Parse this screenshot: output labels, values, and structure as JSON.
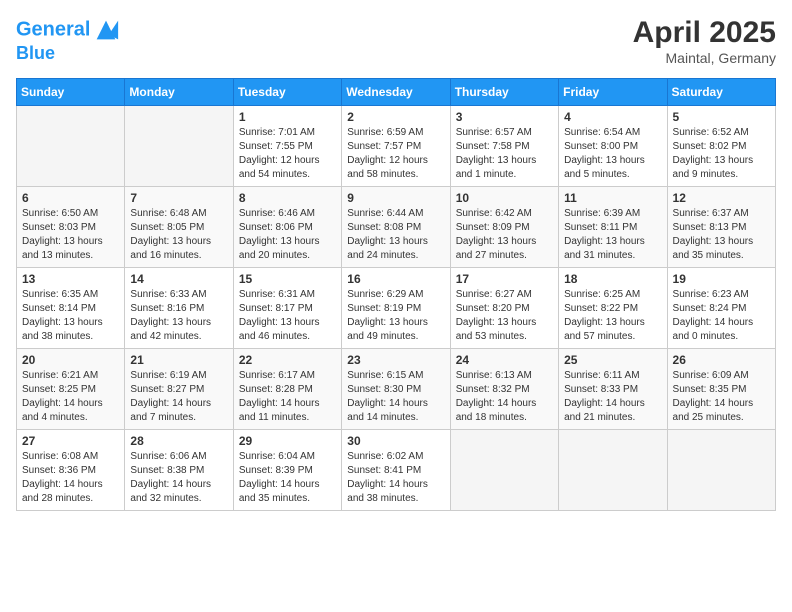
{
  "header": {
    "logo_line1": "General",
    "logo_line2": "Blue",
    "month_year": "April 2025",
    "location": "Maintal, Germany"
  },
  "days_of_week": [
    "Sunday",
    "Monday",
    "Tuesday",
    "Wednesday",
    "Thursday",
    "Friday",
    "Saturday"
  ],
  "weeks": [
    [
      {
        "day": "",
        "info": ""
      },
      {
        "day": "",
        "info": ""
      },
      {
        "day": "1",
        "info": "Sunrise: 7:01 AM\nSunset: 7:55 PM\nDaylight: 12 hours and 54 minutes."
      },
      {
        "day": "2",
        "info": "Sunrise: 6:59 AM\nSunset: 7:57 PM\nDaylight: 12 hours and 58 minutes."
      },
      {
        "day": "3",
        "info": "Sunrise: 6:57 AM\nSunset: 7:58 PM\nDaylight: 13 hours and 1 minute."
      },
      {
        "day": "4",
        "info": "Sunrise: 6:54 AM\nSunset: 8:00 PM\nDaylight: 13 hours and 5 minutes."
      },
      {
        "day": "5",
        "info": "Sunrise: 6:52 AM\nSunset: 8:02 PM\nDaylight: 13 hours and 9 minutes."
      }
    ],
    [
      {
        "day": "6",
        "info": "Sunrise: 6:50 AM\nSunset: 8:03 PM\nDaylight: 13 hours and 13 minutes."
      },
      {
        "day": "7",
        "info": "Sunrise: 6:48 AM\nSunset: 8:05 PM\nDaylight: 13 hours and 16 minutes."
      },
      {
        "day": "8",
        "info": "Sunrise: 6:46 AM\nSunset: 8:06 PM\nDaylight: 13 hours and 20 minutes."
      },
      {
        "day": "9",
        "info": "Sunrise: 6:44 AM\nSunset: 8:08 PM\nDaylight: 13 hours and 24 minutes."
      },
      {
        "day": "10",
        "info": "Sunrise: 6:42 AM\nSunset: 8:09 PM\nDaylight: 13 hours and 27 minutes."
      },
      {
        "day": "11",
        "info": "Sunrise: 6:39 AM\nSunset: 8:11 PM\nDaylight: 13 hours and 31 minutes."
      },
      {
        "day": "12",
        "info": "Sunrise: 6:37 AM\nSunset: 8:13 PM\nDaylight: 13 hours and 35 minutes."
      }
    ],
    [
      {
        "day": "13",
        "info": "Sunrise: 6:35 AM\nSunset: 8:14 PM\nDaylight: 13 hours and 38 minutes."
      },
      {
        "day": "14",
        "info": "Sunrise: 6:33 AM\nSunset: 8:16 PM\nDaylight: 13 hours and 42 minutes."
      },
      {
        "day": "15",
        "info": "Sunrise: 6:31 AM\nSunset: 8:17 PM\nDaylight: 13 hours and 46 minutes."
      },
      {
        "day": "16",
        "info": "Sunrise: 6:29 AM\nSunset: 8:19 PM\nDaylight: 13 hours and 49 minutes."
      },
      {
        "day": "17",
        "info": "Sunrise: 6:27 AM\nSunset: 8:20 PM\nDaylight: 13 hours and 53 minutes."
      },
      {
        "day": "18",
        "info": "Sunrise: 6:25 AM\nSunset: 8:22 PM\nDaylight: 13 hours and 57 minutes."
      },
      {
        "day": "19",
        "info": "Sunrise: 6:23 AM\nSunset: 8:24 PM\nDaylight: 14 hours and 0 minutes."
      }
    ],
    [
      {
        "day": "20",
        "info": "Sunrise: 6:21 AM\nSunset: 8:25 PM\nDaylight: 14 hours and 4 minutes."
      },
      {
        "day": "21",
        "info": "Sunrise: 6:19 AM\nSunset: 8:27 PM\nDaylight: 14 hours and 7 minutes."
      },
      {
        "day": "22",
        "info": "Sunrise: 6:17 AM\nSunset: 8:28 PM\nDaylight: 14 hours and 11 minutes."
      },
      {
        "day": "23",
        "info": "Sunrise: 6:15 AM\nSunset: 8:30 PM\nDaylight: 14 hours and 14 minutes."
      },
      {
        "day": "24",
        "info": "Sunrise: 6:13 AM\nSunset: 8:32 PM\nDaylight: 14 hours and 18 minutes."
      },
      {
        "day": "25",
        "info": "Sunrise: 6:11 AM\nSunset: 8:33 PM\nDaylight: 14 hours and 21 minutes."
      },
      {
        "day": "26",
        "info": "Sunrise: 6:09 AM\nSunset: 8:35 PM\nDaylight: 14 hours and 25 minutes."
      }
    ],
    [
      {
        "day": "27",
        "info": "Sunrise: 6:08 AM\nSunset: 8:36 PM\nDaylight: 14 hours and 28 minutes."
      },
      {
        "day": "28",
        "info": "Sunrise: 6:06 AM\nSunset: 8:38 PM\nDaylight: 14 hours and 32 minutes."
      },
      {
        "day": "29",
        "info": "Sunrise: 6:04 AM\nSunset: 8:39 PM\nDaylight: 14 hours and 35 minutes."
      },
      {
        "day": "30",
        "info": "Sunrise: 6:02 AM\nSunset: 8:41 PM\nDaylight: 14 hours and 38 minutes."
      },
      {
        "day": "",
        "info": ""
      },
      {
        "day": "",
        "info": ""
      },
      {
        "day": "",
        "info": ""
      }
    ]
  ]
}
